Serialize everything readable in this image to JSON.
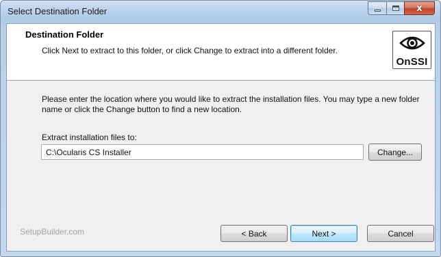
{
  "window": {
    "title": "Select Destination Folder",
    "close_glyph": "x"
  },
  "header": {
    "title": "Destination Folder",
    "description": "Click Next to extract to this folder, or click Change to extract into a different folder.",
    "logo_text": "OnSSI"
  },
  "main": {
    "instructions": "Please enter the location where you would like to extract the installation files. You may type a new folder name or click the Change button to find a new location.",
    "extract_label": "Extract installation files to:",
    "extract_path": "C:\\Ocularis CS Installer",
    "change_label": "Change..."
  },
  "footer": {
    "brand": "SetupBuilder.com",
    "back_label": "< Back",
    "next_label": "Next >",
    "cancel_label": "Cancel"
  },
  "colors": {
    "title_bar": "#bcd3ec",
    "close_button": "#c2432a",
    "default_button_border": "#3c7fb1"
  }
}
